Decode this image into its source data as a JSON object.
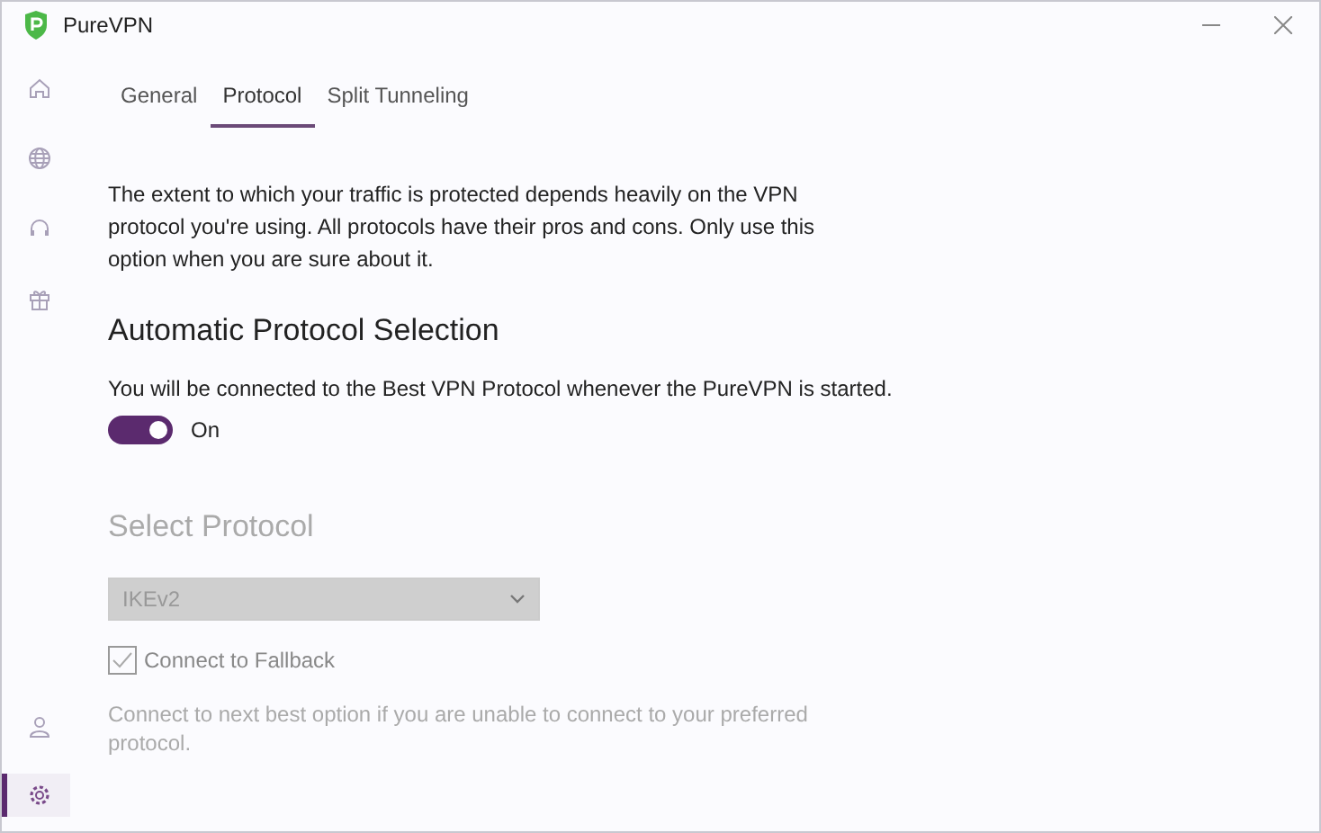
{
  "window": {
    "title": "PureVPN"
  },
  "sidebar": {
    "top": [
      {
        "kind": "home",
        "selected": false
      },
      {
        "kind": "globe",
        "selected": false
      },
      {
        "kind": "headset",
        "selected": false
      },
      {
        "kind": "gift",
        "selected": false
      }
    ],
    "bottom": [
      {
        "kind": "user",
        "selected": false
      },
      {
        "kind": "gear",
        "selected": true
      }
    ]
  },
  "tabs": [
    {
      "label": "General",
      "selected": false
    },
    {
      "label": "Protocol",
      "selected": true
    },
    {
      "label": "Split Tunneling",
      "selected": false
    }
  ],
  "intro": "The extent to which your traffic is protected depends heavily on the VPN protocol you're using. All protocols have their pros and cons. Only use this option when you are sure about it.",
  "auto_selection": {
    "heading": "Automatic Protocol Selection",
    "description": "You will be connected to the Best VPN Protocol whenever the PureVPN is started.",
    "toggle": {
      "on": true,
      "label": "On"
    }
  },
  "select_protocol": {
    "heading": "Select Protocol",
    "disabled": true,
    "dropdown": {
      "value": "IKEv2"
    },
    "fallback": {
      "label": "Connect to Fallback",
      "checked": true
    },
    "note": "Connect to next best option if you are unable to connect to your preferred protocol."
  }
}
